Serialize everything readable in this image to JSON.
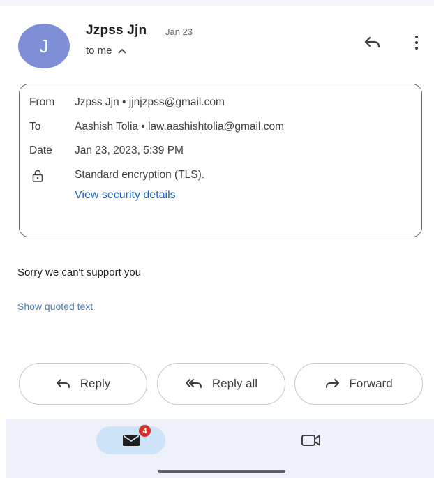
{
  "header": {
    "avatar_letter": "J",
    "sender_name": "Jzpss Jjn",
    "date_short": "Jan 23",
    "to_me": "to me"
  },
  "details": {
    "from_label": "From",
    "from_value": "Jzpss Jjn • jjnjzpss@gmail.com",
    "to_label": "To",
    "to_value": "Aashish Tolia • law.aashishtolia@gmail.com",
    "date_label": "Date",
    "date_value": "Jan 23, 2023, 5:39 PM",
    "encryption": "Standard encryption (TLS).",
    "security_link": "View security details"
  },
  "body": {
    "message": "Sorry we can't support you",
    "show_quoted": "Show quoted text"
  },
  "actions": {
    "reply": "Reply",
    "reply_all": "Reply all",
    "forward": "Forward"
  },
  "bottom_nav": {
    "mail_badge": "4"
  },
  "colors": {
    "avatar": "#7e8fd8",
    "link": "#1a62b8",
    "badge": "#d93025",
    "nav_active": "#cde3f8",
    "nav_bg": "#eef1f9"
  }
}
